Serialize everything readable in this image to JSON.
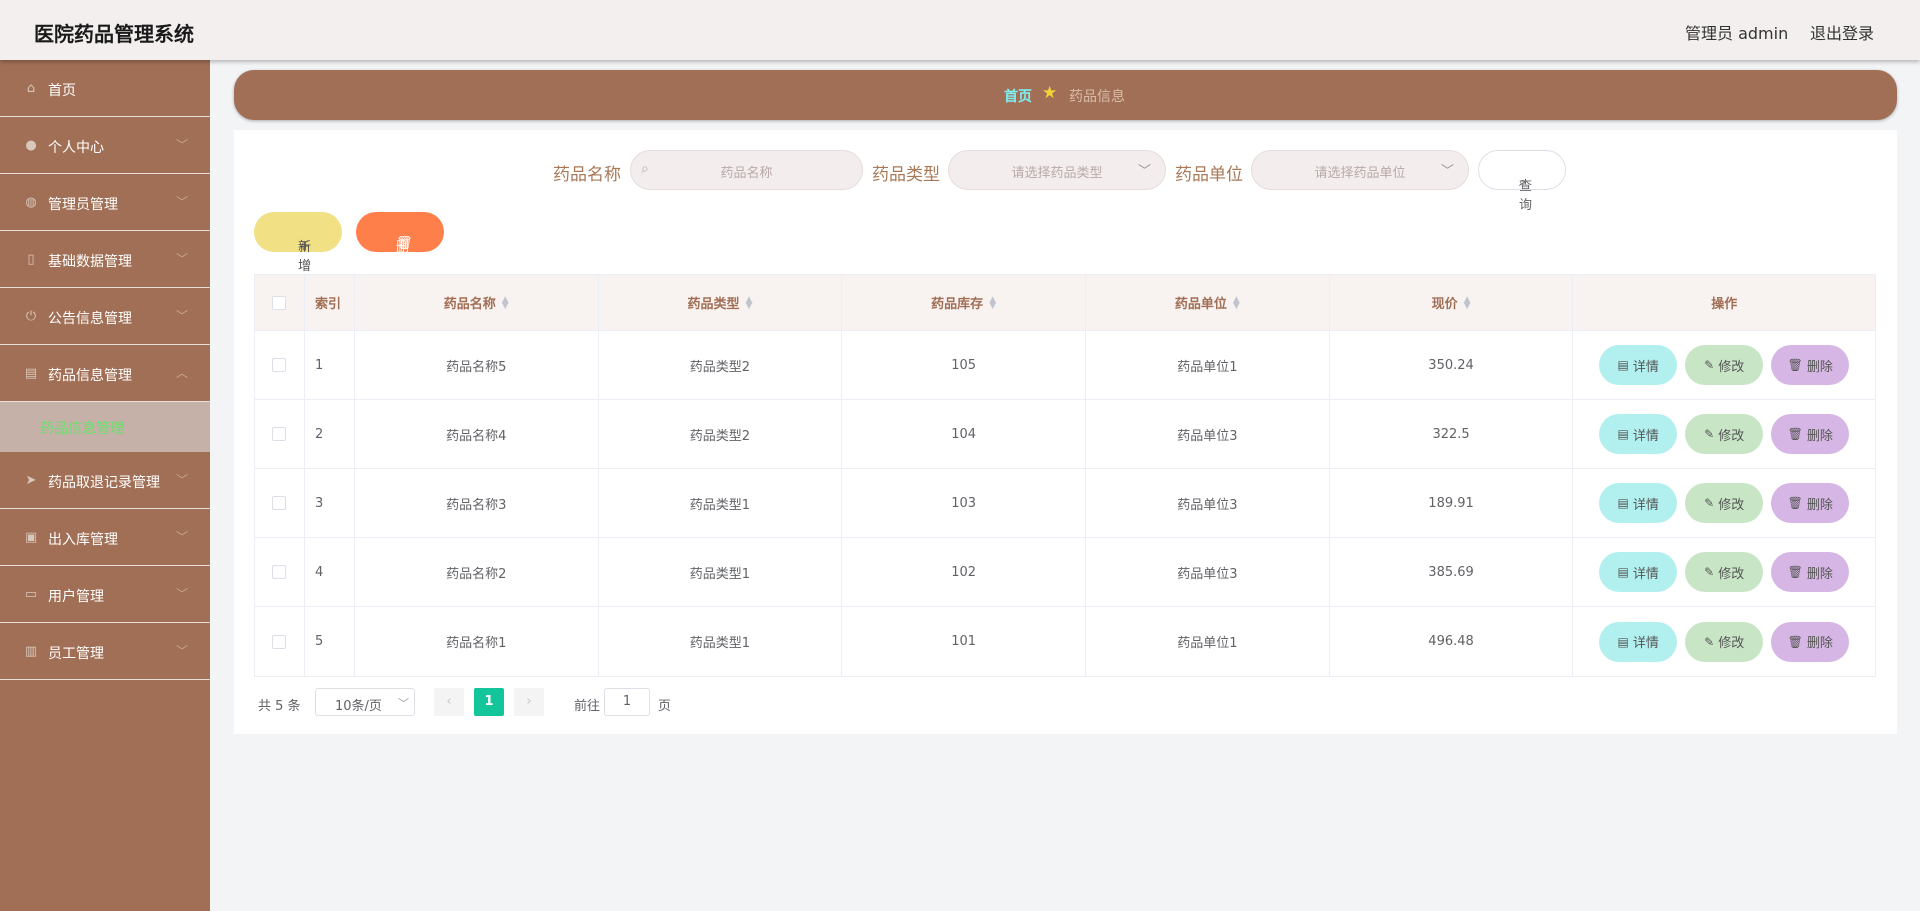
{
  "header": {
    "title": "医院药品管理系统",
    "user": "管理员 admin",
    "logout": "退出登录"
  },
  "sidebar": {
    "items": [
      {
        "label": "首页",
        "icon": "home-icon",
        "glyph": "⌂",
        "arrow": false
      },
      {
        "label": "个人中心",
        "icon": "user-icon",
        "glyph": "●",
        "arrow": true
      },
      {
        "label": "管理员管理",
        "icon": "settings-icon",
        "glyph": "◍",
        "arrow": true
      },
      {
        "label": "基础数据管理",
        "icon": "phone-icon",
        "glyph": "▯",
        "arrow": true
      },
      {
        "label": "公告信息管理",
        "icon": "power-icon",
        "glyph": "⏻",
        "arrow": true
      },
      {
        "label": "药品信息管理",
        "icon": "chat-icon",
        "glyph": "▤",
        "arrow": true,
        "open": true
      }
    ],
    "submenu": {
      "label": "药品信息管理"
    },
    "items_after": [
      {
        "label": "药品取退记录管理",
        "icon": "send-icon",
        "glyph": "➤",
        "arrow": true
      },
      {
        "label": "出入库管理",
        "icon": "tag-icon",
        "glyph": "▣",
        "arrow": true
      },
      {
        "label": "用户管理",
        "icon": "briefcase-icon",
        "glyph": "▭",
        "arrow": true
      },
      {
        "label": "员工管理",
        "icon": "bar-chart-icon",
        "glyph": "▥",
        "arrow": true
      }
    ],
    "arrow_down": "﹀",
    "arrow_up": "︿"
  },
  "breadcrumb": {
    "home": "首页",
    "current": "药品信息"
  },
  "search": {
    "name_label": "药品名称",
    "name_placeholder": "药品名称",
    "type_label": "药品类型",
    "type_placeholder": "请选择药品类型",
    "unit_label": "药品单位",
    "unit_placeholder": "请选择药品单位",
    "query": "查询"
  },
  "actions": {
    "add": "新增",
    "delete": "删除"
  },
  "table": {
    "headers": [
      "索引",
      "药品名称",
      "药品类型",
      "药品库存",
      "药品单位",
      "现价",
      "操作"
    ],
    "rows": [
      [
        "1",
        "药品名称5",
        "药品类型2",
        "105",
        "药品单位1",
        "350.24"
      ],
      [
        "2",
        "药品名称4",
        "药品类型2",
        "104",
        "药品单位3",
        "322.5"
      ],
      [
        "3",
        "药品名称3",
        "药品类型1",
        "103",
        "药品单位3",
        "189.91"
      ],
      [
        "4",
        "药品名称2",
        "药品类型1",
        "102",
        "药品单位3",
        "385.69"
      ],
      [
        "5",
        "药品名称1",
        "药品类型1",
        "101",
        "药品单位1",
        "496.48"
      ]
    ],
    "ops": {
      "detail": "详情",
      "edit": "修改",
      "delete": "删除"
    }
  },
  "pagination": {
    "total": "共 5 条",
    "page_size": "10条/页",
    "current_page": "1",
    "goto": "前往",
    "goto_value": "1",
    "page_suffix": "页"
  },
  "colors": {
    "accent": "#a16f55",
    "active_page": "#13c59a",
    "submenu_text": "#6be06b"
  }
}
